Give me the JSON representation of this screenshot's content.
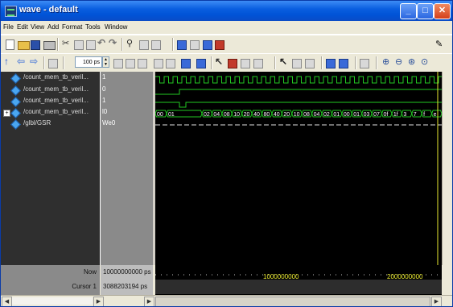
{
  "window": {
    "title": "wave - default"
  },
  "menu": [
    "File",
    "Edit",
    "View",
    "Add",
    "Format",
    "Tools",
    "Window"
  ],
  "toolbar": {
    "time_step_value": "100 ps"
  },
  "signals": [
    {
      "name": "/count_mem_tb_veril...",
      "value": "1",
      "expandable": false
    },
    {
      "name": "/count_mem_tb_veril...",
      "value": "0",
      "expandable": false
    },
    {
      "name": "/count_mem_tb_veril...",
      "value": "1",
      "expandable": false
    },
    {
      "name": "/count_mem_tb_veril...",
      "value": "l0",
      "expandable": true
    },
    {
      "name": "/glbl/GSR",
      "value": "We0",
      "expandable": false
    }
  ],
  "bus_labels": [
    "00",
    "01",
    "02",
    "04",
    "08",
    "10",
    "20",
    "40",
    "80",
    "40",
    "20",
    "10",
    "08",
    "04",
    "02",
    "01",
    "00",
    "01",
    "03",
    "07",
    "0f",
    "1f",
    "3",
    "7",
    "f",
    "e"
  ],
  "status": {
    "now_label": "Now",
    "now_value": "10000000000 ps",
    "cursor_label": "Cursor 1",
    "cursor_value": "3088203194 ps"
  },
  "ruler": {
    "tick_labels": [
      "1000000000",
      "2000000000"
    ]
  },
  "colors": {
    "signal_green": "#22c822",
    "cursor_yellow": "#e8e830",
    "names_bg": "#2f2f2f",
    "values_bg": "#8a8a8a"
  }
}
